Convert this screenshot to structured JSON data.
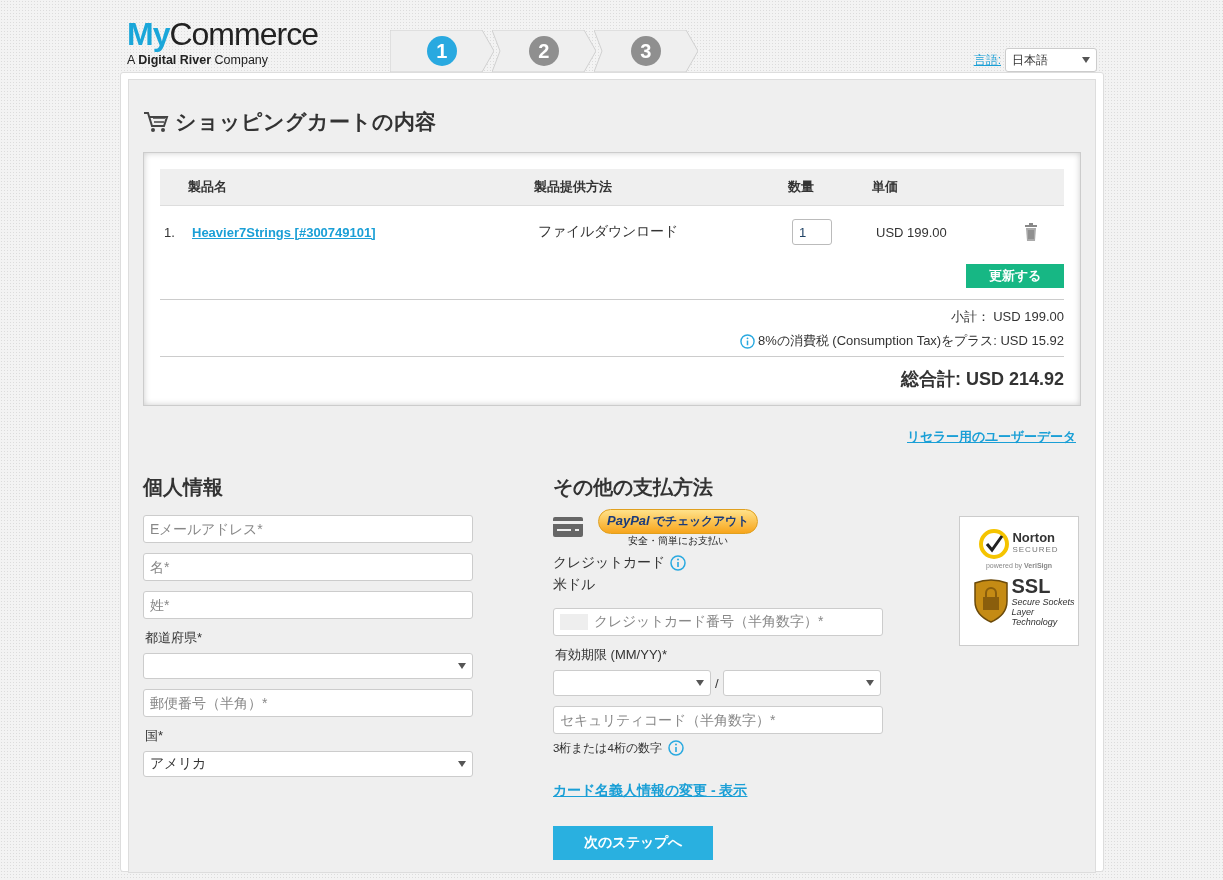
{
  "logo": {
    "prefix": "My",
    "name": "Commerce",
    "tagline": "A **Digital River** Company"
  },
  "steps": [
    {
      "label": "1",
      "selected": true
    },
    {
      "label": "2",
      "selected": false
    },
    {
      "label": "3",
      "selected": false
    }
  ],
  "language": {
    "label": "言語:",
    "value": "日本語"
  },
  "cart": {
    "title": "ショッピングカートの内容",
    "columns": [
      "製品名",
      "製品提供方法",
      "数量",
      "単価"
    ],
    "rows": [
      {
        "index": "1.",
        "product": "Heavier7Strings [#300749101]",
        "delivery": "ファイルダウンロード",
        "quantity": "1",
        "price": "USD 199.00"
      }
    ],
    "update_button": "更新する",
    "subtotal": "小計： USD 199.00",
    "tax": "8%の消費税 (Consumption Tax)をプラス: USD 15.92",
    "total": "総合計: USD 214.92"
  },
  "reseller_link": "リセラー用のユーザーデータ",
  "personal": {
    "title": "個人情報",
    "fields": [
      {
        "kind": "input",
        "placeholder": "Eメールアドレス*"
      },
      {
        "kind": "input",
        "placeholder": "名*"
      },
      {
        "kind": "input",
        "placeholder": "姓*"
      },
      {
        "kind": "select",
        "label": "都道府県*"
      },
      {
        "kind": "input",
        "placeholder": "郵便番号（半角）*"
      },
      {
        "kind": "select",
        "label": "国*",
        "value": "アメリカ"
      }
    ]
  },
  "payment": {
    "title": "その他の支払方法",
    "paypal": {
      "brand": "PayPal",
      "text": "でチェックアウト",
      "caption": "安全・簡単にお支払い"
    },
    "method": "クレジットカード",
    "currency": "米ドル",
    "card_number": {
      "placeholder": "クレジットカード番号（半角数字）*"
    },
    "expiry_label": "有効期限 (MM/YY)*",
    "expiry_separator": "/",
    "security_code": {
      "placeholder": "セキュリティコード（半角数字）*"
    },
    "security_hint": "3桁または4桁の数字",
    "cardholder_link": "カード名義人情報の変更 - 表示",
    "next_button": "次のステップへ"
  },
  "trust_badges": {
    "norton": "Norton",
    "secured": "SECURED",
    "powered": "powered by **VeriSign**",
    "ssl": "SSL",
    "ssl_caption": "Secure Sockets Layer Technology"
  }
}
